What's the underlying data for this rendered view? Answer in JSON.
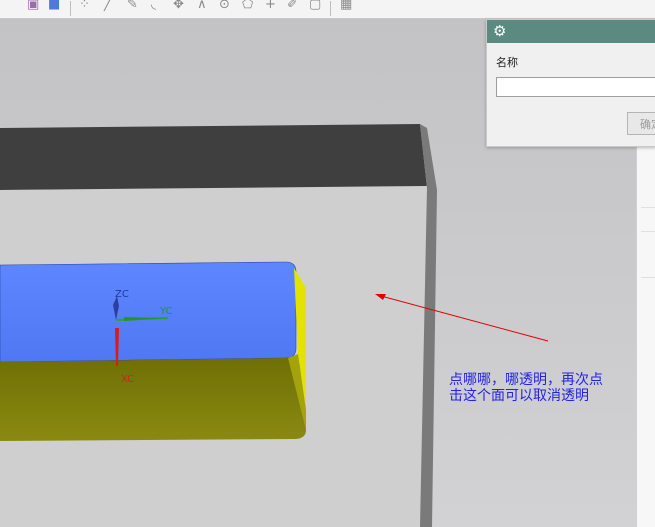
{
  "toolbar": {
    "icons": [
      "cube-shaded-icon",
      "cube-blue-icon",
      "snap-point-icon",
      "line-icon",
      "pen-icon",
      "arc-icon",
      "move-icon",
      "axis-icon",
      "circle-point-icon",
      "pentagon-icon",
      "plus-icon",
      "pencil-icon",
      "box-select-icon",
      "grid-icon"
    ]
  },
  "dialog": {
    "title_icon": "gear-icon",
    "name_label": "名称",
    "name_value": "",
    "ok_label": "确定"
  },
  "model": {
    "axis_labels": {
      "z": "ZC",
      "y": "YC",
      "x": "XC"
    }
  },
  "annotation": {
    "line1": "点哪哪，哪透明，再次点",
    "line2": "击这个面可以取消透明"
  },
  "colors": {
    "viewport_background": "#c9c9cb",
    "panel_top": "#3f3f3f",
    "blue_face": "#5b82fb",
    "olive_face": "#7b7b08",
    "yellow_side": "#e5e500",
    "arrow": "#e00000",
    "annotation_text": "#2222ee",
    "dialog_title": "#5a8a80"
  }
}
